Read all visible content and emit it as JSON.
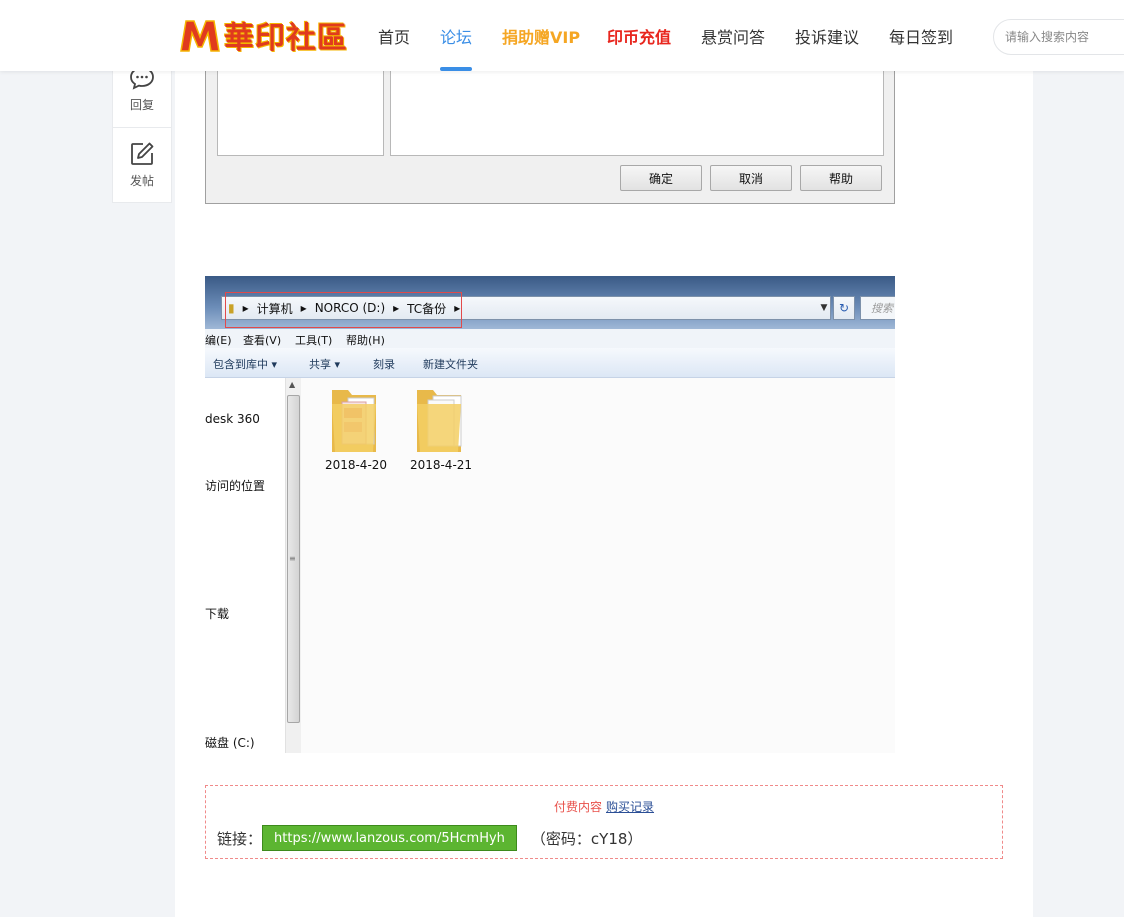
{
  "site": {
    "logo_text": "華印社區"
  },
  "nav": {
    "items": [
      {
        "label": "首页"
      },
      {
        "label": "论坛"
      },
      {
        "label": "捐助赠VIP"
      },
      {
        "label": "印币充值"
      },
      {
        "label": "悬赏问答"
      },
      {
        "label": "投诉建议"
      },
      {
        "label": "每日签到"
      }
    ],
    "active": "论坛",
    "search_placeholder": "请输入搜索内容"
  },
  "sidebar": {
    "reply_label": "回复",
    "post_label": "发帖"
  },
  "dialog_screenshot": {
    "buttons": [
      "确定",
      "取消",
      "帮助"
    ]
  },
  "explorer_screenshot": {
    "breadcrumb": [
      "计算机",
      "NORCO (D:)",
      "TC备份"
    ],
    "search_placeholder": "搜索",
    "menu": [
      "编(E)",
      "查看(V)",
      "工具(T)",
      "帮助(H)"
    ],
    "toolbar": [
      "包含到库中 ▾",
      "共享 ▾",
      "刻录",
      "新建文件夹"
    ],
    "nav_items": [
      "desk 360",
      "访问的位置",
      "下载",
      "磁盘 (C:)"
    ],
    "folders": [
      "2018-4-20",
      "2018-4-21"
    ]
  },
  "paid_content": {
    "tag": "付费内容",
    "purchase_link": "购买记录",
    "link_label": "链接：",
    "link_text": "https://www.lanzous.com/5HcmHyh",
    "password_text": "（密码：cY18）"
  },
  "colors": {
    "nav_active": "#3a8ee6",
    "vip_orange": "#f5a623",
    "coin_red": "#e8261e",
    "download_green": "#5cb531",
    "paid_border": "#f08a8a"
  }
}
